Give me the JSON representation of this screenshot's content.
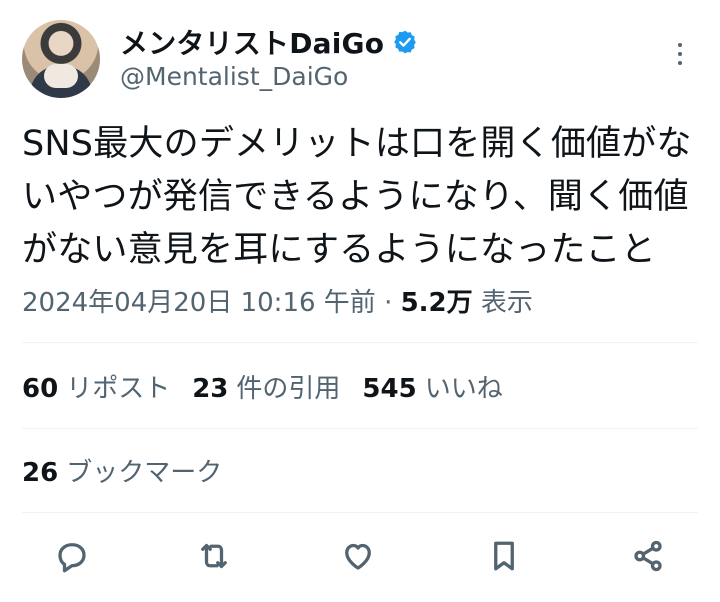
{
  "author": {
    "display_name": "メンタリストDaiGo",
    "handle": "@Mentalist_DaiGo",
    "verified_color": "#1d9bf0"
  },
  "tweet": {
    "text": "SNS最大のデメリットは口を開く価値がないやつが発信できるようになり、聞く価値がない意見を耳にするようになったこと",
    "lines": [
      "SNS最大のデメリットは口を開く価値がな",
      "いやつが発信できるようになり、聞く価値",
      "がない意見を耳にするようになったこと"
    ]
  },
  "meta": {
    "timestamp": "2024年04月20日 10:16 午前",
    "separator": "·",
    "views_count": "5.2万",
    "views_label": "表示"
  },
  "stats": {
    "reposts_count": "60",
    "reposts_label": "リポスト",
    "quotes_count": "23",
    "quotes_label": "件の引用",
    "likes_count": "545",
    "likes_label": "いいね",
    "bookmarks_count": "26",
    "bookmarks_label": "ブックマーク"
  },
  "actions": [
    "reply-icon",
    "repost-icon",
    "like-icon",
    "bookmark-icon",
    "share-icon"
  ],
  "colors": {
    "text": "#0f1419",
    "secondary": "#536471",
    "divider": "#eff3f4"
  }
}
